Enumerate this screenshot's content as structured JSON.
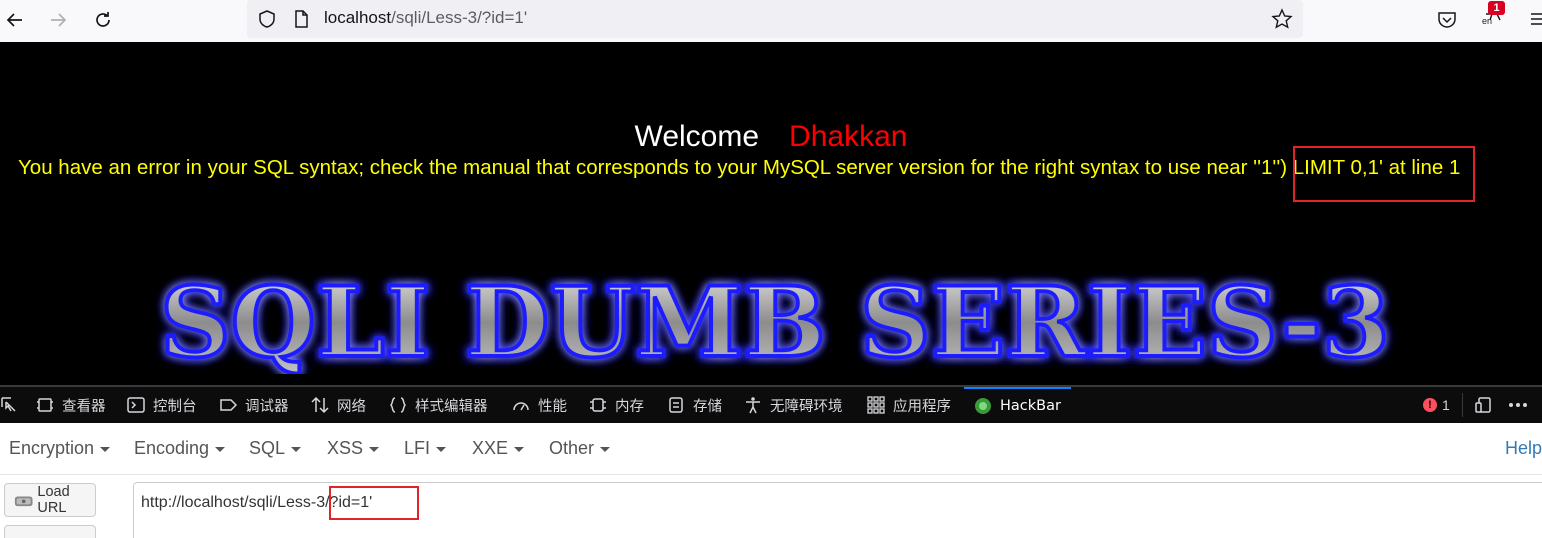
{
  "browser": {
    "url_host": "localhost",
    "url_path": "/sqli/Less-3/?id=1'",
    "badge_count": "1",
    "ext_label": "en"
  },
  "page": {
    "welcome_label": "Welcome",
    "welcome_name": "Dhakkan",
    "error_message": "You have an error in your SQL syntax; check the manual that corresponds to your MySQL server version for the right syntax to use near ''1'') LIMIT 0,1' at line 1",
    "logo_text": "SQLI DUMB SERIES-3"
  },
  "devtools": {
    "tabs": [
      {
        "label": "查看器",
        "icon": "inspector-icon"
      },
      {
        "label": "控制台",
        "icon": "console-icon"
      },
      {
        "label": "调试器",
        "icon": "debugger-icon"
      },
      {
        "label": "网络",
        "icon": "network-icon"
      },
      {
        "label": "样式编辑器",
        "icon": "style-editor-icon"
      },
      {
        "label": "性能",
        "icon": "performance-icon"
      },
      {
        "label": "内存",
        "icon": "memory-icon"
      },
      {
        "label": "存储",
        "icon": "storage-icon"
      },
      {
        "label": "无障碍环境",
        "icon": "accessibility-icon"
      },
      {
        "label": "应用程序",
        "icon": "application-icon"
      },
      {
        "label": "HackBar",
        "icon": "hackbar-icon"
      }
    ],
    "error_count": "1"
  },
  "hackbar": {
    "menu": [
      "Encryption",
      "Encoding",
      "SQL",
      "XSS",
      "LFI",
      "XXE",
      "Other"
    ],
    "help_label": "Help",
    "load_url_label": "Load URL",
    "url_value": "http://localhost/sqli/Less-3/?id=1'"
  },
  "colors": {
    "page_background": "#000000",
    "welcome_text": "#ffffff",
    "name_text": "#ff0000",
    "error_text": "#ffff00",
    "highlight_box": "#e0242a",
    "devtools_bg": "#0c0c0d",
    "active_tab_accent": "#0a84ff"
  }
}
